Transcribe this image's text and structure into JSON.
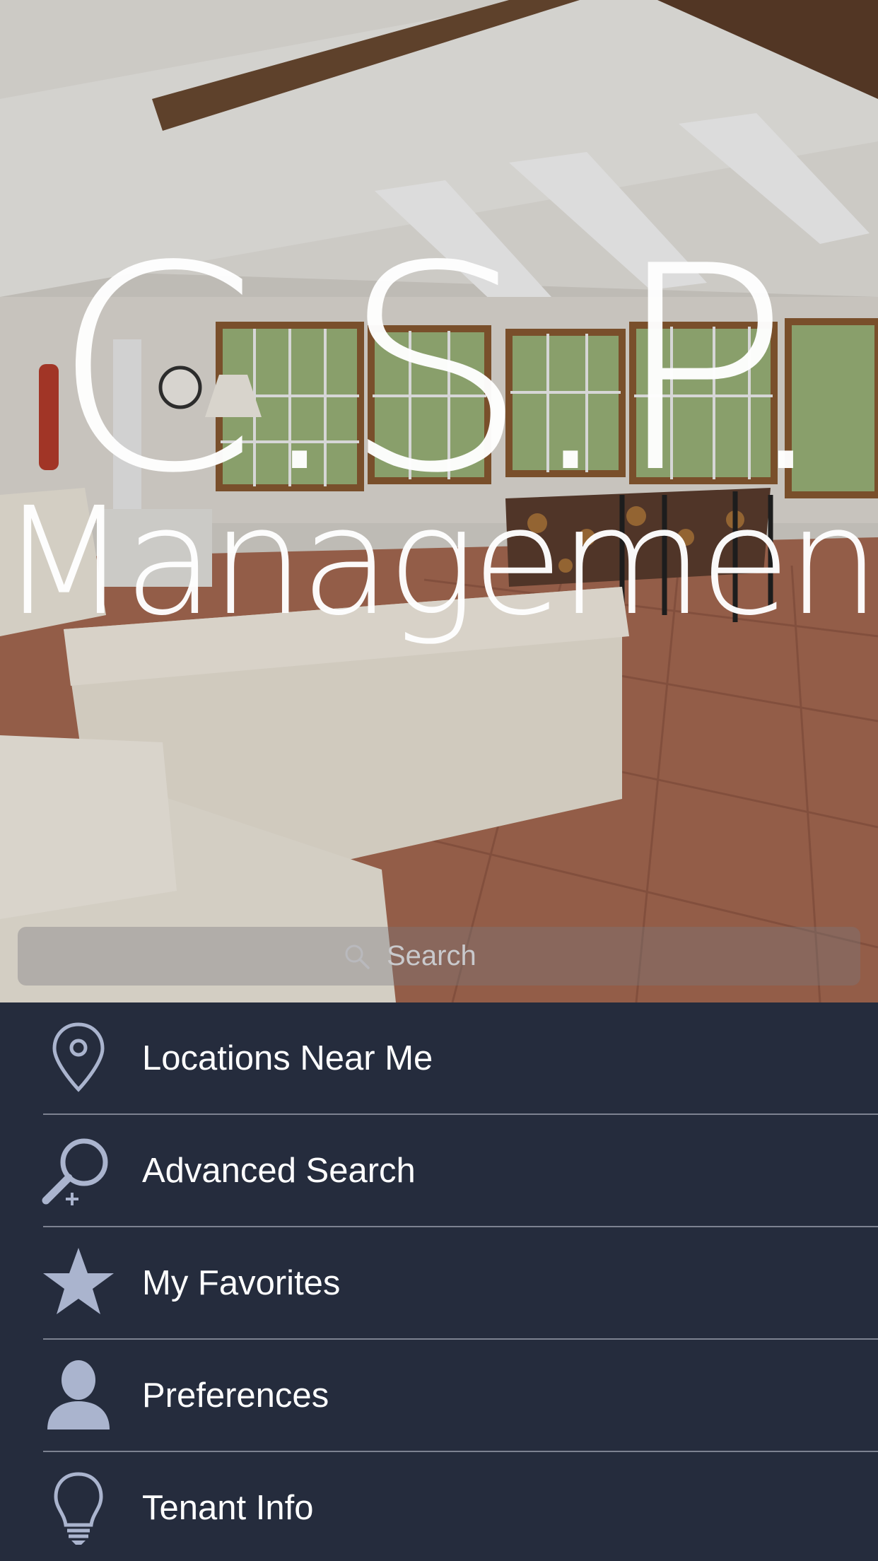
{
  "app": {
    "logo_line1": "C.S.P.",
    "logo_line2": "Management"
  },
  "search": {
    "placeholder": "Search",
    "icon": "search-icon"
  },
  "menu": {
    "items": [
      {
        "label": "Locations Near Me",
        "icon": "location-pin-icon"
      },
      {
        "label": "Advanced Search",
        "icon": "magnifier-plus-icon"
      },
      {
        "label": "My Favorites",
        "icon": "star-icon"
      },
      {
        "label": "Preferences",
        "icon": "person-icon"
      },
      {
        "label": "Tenant Info",
        "icon": "lightbulb-icon"
      }
    ]
  },
  "colors": {
    "menu_background": "#252c3d",
    "icon_color": "#aab4ce",
    "divider": "#7d8291",
    "text": "#ffffff"
  }
}
